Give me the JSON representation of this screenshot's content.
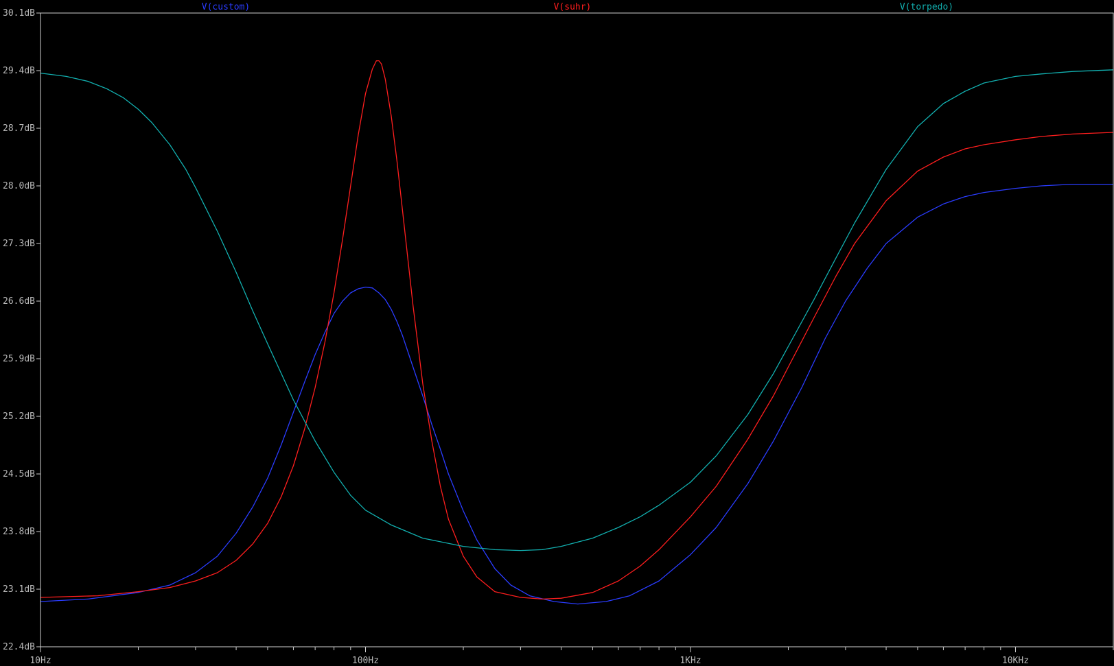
{
  "chart_data": {
    "type": "line",
    "xscale": "log",
    "xlim": [
      10,
      20000
    ],
    "ylim": [
      22.4,
      30.1
    ],
    "x_ticks": [
      {
        "value": 10,
        "label": "10Hz"
      },
      {
        "value": 100,
        "label": "100Hz"
      },
      {
        "value": 1000,
        "label": "1KHz"
      },
      {
        "value": 10000,
        "label": "10KHz"
      }
    ],
    "y_ticks": [
      {
        "value": 30.1,
        "label": "30.1dB"
      },
      {
        "value": 29.4,
        "label": "29.4dB"
      },
      {
        "value": 28.7,
        "label": "28.7dB"
      },
      {
        "value": 28.0,
        "label": "28.0dB"
      },
      {
        "value": 27.3,
        "label": "27.3dB"
      },
      {
        "value": 26.6,
        "label": "26.6dB"
      },
      {
        "value": 25.9,
        "label": "25.9dB"
      },
      {
        "value": 25.2,
        "label": "25.2dB"
      },
      {
        "value": 24.5,
        "label": "24.5dB"
      },
      {
        "value": 23.8,
        "label": "23.8dB"
      },
      {
        "value": 23.1,
        "label": "23.1dB"
      },
      {
        "value": 22.4,
        "label": "22.4dB"
      }
    ],
    "legend_placement": "top",
    "grid": false,
    "colors": {
      "background": "#000000",
      "axis": "#cfcfcf"
    },
    "series": [
      {
        "name": "V(custom)",
        "color": "#2a3cff",
        "points": [
          [
            10,
            22.95
          ],
          [
            14,
            22.98
          ],
          [
            20,
            23.06
          ],
          [
            25,
            23.15
          ],
          [
            30,
            23.3
          ],
          [
            35,
            23.5
          ],
          [
            40,
            23.78
          ],
          [
            45,
            24.1
          ],
          [
            50,
            24.45
          ],
          [
            55,
            24.85
          ],
          [
            60,
            25.25
          ],
          [
            65,
            25.62
          ],
          [
            70,
            25.95
          ],
          [
            75,
            26.22
          ],
          [
            80,
            26.45
          ],
          [
            85,
            26.6
          ],
          [
            90,
            26.7
          ],
          [
            95,
            26.75
          ],
          [
            100,
            26.77
          ],
          [
            105,
            26.76
          ],
          [
            110,
            26.7
          ],
          [
            115,
            26.62
          ],
          [
            120,
            26.5
          ],
          [
            125,
            26.35
          ],
          [
            130,
            26.18
          ],
          [
            140,
            25.8
          ],
          [
            150,
            25.45
          ],
          [
            160,
            25.1
          ],
          [
            170,
            24.8
          ],
          [
            180,
            24.5
          ],
          [
            200,
            24.05
          ],
          [
            220,
            23.7
          ],
          [
            250,
            23.35
          ],
          [
            280,
            23.15
          ],
          [
            320,
            23.02
          ],
          [
            380,
            22.95
          ],
          [
            450,
            22.92
          ],
          [
            550,
            22.95
          ],
          [
            650,
            23.02
          ],
          [
            800,
            23.2
          ],
          [
            1000,
            23.52
          ],
          [
            1200,
            23.85
          ],
          [
            1500,
            24.38
          ],
          [
            1800,
            24.9
          ],
          [
            2200,
            25.55
          ],
          [
            2600,
            26.15
          ],
          [
            3000,
            26.6
          ],
          [
            3500,
            27.0
          ],
          [
            4000,
            27.3
          ],
          [
            5000,
            27.62
          ],
          [
            6000,
            27.78
          ],
          [
            7000,
            27.87
          ],
          [
            8000,
            27.92
          ],
          [
            10000,
            27.97
          ],
          [
            12000,
            28.0
          ],
          [
            15000,
            28.02
          ],
          [
            20000,
            28.02
          ]
        ]
      },
      {
        "name": "V(suhr)",
        "color": "#ff1e1e",
        "points": [
          [
            10,
            23.0
          ],
          [
            15,
            23.02
          ],
          [
            20,
            23.07
          ],
          [
            25,
            23.12
          ],
          [
            30,
            23.2
          ],
          [
            35,
            23.3
          ],
          [
            40,
            23.45
          ],
          [
            45,
            23.65
          ],
          [
            50,
            23.9
          ],
          [
            55,
            24.22
          ],
          [
            60,
            24.6
          ],
          [
            65,
            25.05
          ],
          [
            70,
            25.55
          ],
          [
            75,
            26.1
          ],
          [
            80,
            26.7
          ],
          [
            85,
            27.35
          ],
          [
            90,
            28.0
          ],
          [
            95,
            28.62
          ],
          [
            100,
            29.12
          ],
          [
            105,
            29.42
          ],
          [
            108,
            29.52
          ],
          [
            110,
            29.52
          ],
          [
            112,
            29.48
          ],
          [
            115,
            29.3
          ],
          [
            120,
            28.85
          ],
          [
            125,
            28.3
          ],
          [
            130,
            27.7
          ],
          [
            140,
            26.55
          ],
          [
            150,
            25.6
          ],
          [
            160,
            24.9
          ],
          [
            170,
            24.35
          ],
          [
            180,
            23.95
          ],
          [
            200,
            23.5
          ],
          [
            220,
            23.25
          ],
          [
            250,
            23.07
          ],
          [
            300,
            23.0
          ],
          [
            350,
            22.98
          ],
          [
            400,
            22.99
          ],
          [
            500,
            23.06
          ],
          [
            600,
            23.2
          ],
          [
            700,
            23.38
          ],
          [
            800,
            23.58
          ],
          [
            1000,
            23.98
          ],
          [
            1200,
            24.35
          ],
          [
            1500,
            24.92
          ],
          [
            1800,
            25.45
          ],
          [
            2000,
            25.8
          ],
          [
            2400,
            26.4
          ],
          [
            2800,
            26.9
          ],
          [
            3200,
            27.3
          ],
          [
            4000,
            27.82
          ],
          [
            5000,
            28.18
          ],
          [
            6000,
            28.35
          ],
          [
            7000,
            28.45
          ],
          [
            8000,
            28.5
          ],
          [
            10000,
            28.56
          ],
          [
            12000,
            28.6
          ],
          [
            15000,
            28.63
          ],
          [
            20000,
            28.65
          ]
        ]
      },
      {
        "name": "V(torpedo)",
        "color": "#12b0b0",
        "points": [
          [
            10,
            29.37
          ],
          [
            12,
            29.33
          ],
          [
            14,
            29.27
          ],
          [
            16,
            29.18
          ],
          [
            18,
            29.07
          ],
          [
            20,
            28.93
          ],
          [
            22,
            28.77
          ],
          [
            25,
            28.5
          ],
          [
            28,
            28.2
          ],
          [
            30,
            27.98
          ],
          [
            35,
            27.45
          ],
          [
            40,
            26.95
          ],
          [
            45,
            26.48
          ],
          [
            50,
            26.08
          ],
          [
            60,
            25.4
          ],
          [
            70,
            24.9
          ],
          [
            80,
            24.52
          ],
          [
            90,
            24.24
          ],
          [
            100,
            24.06
          ],
          [
            120,
            23.88
          ],
          [
            150,
            23.72
          ],
          [
            200,
            23.62
          ],
          [
            250,
            23.58
          ],
          [
            300,
            23.57
          ],
          [
            350,
            23.58
          ],
          [
            400,
            23.62
          ],
          [
            500,
            23.72
          ],
          [
            600,
            23.85
          ],
          [
            700,
            23.98
          ],
          [
            800,
            24.12
          ],
          [
            1000,
            24.4
          ],
          [
            1200,
            24.72
          ],
          [
            1500,
            25.22
          ],
          [
            1800,
            25.72
          ],
          [
            2000,
            26.05
          ],
          [
            2400,
            26.62
          ],
          [
            2800,
            27.12
          ],
          [
            3200,
            27.55
          ],
          [
            4000,
            28.2
          ],
          [
            5000,
            28.72
          ],
          [
            6000,
            29.0
          ],
          [
            7000,
            29.15
          ],
          [
            8000,
            29.25
          ],
          [
            10000,
            29.33
          ],
          [
            12000,
            29.36
          ],
          [
            15000,
            29.39
          ],
          [
            20000,
            29.41
          ]
        ]
      }
    ]
  }
}
